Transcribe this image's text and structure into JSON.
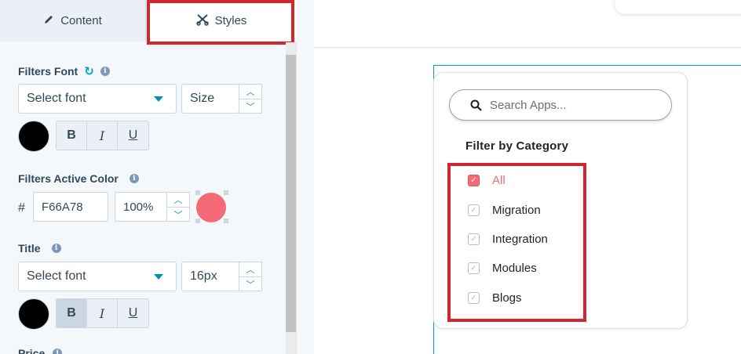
{
  "tabs": {
    "content_label": "Content",
    "styles_label": "Styles"
  },
  "filters_font": {
    "label": "Filters Font",
    "font_value": "Select font",
    "size_value": "Size",
    "bold": "B",
    "italic": "I",
    "underline": "U",
    "color": "#000000"
  },
  "filters_active_color": {
    "label": "Filters Active Color",
    "hash": "#",
    "hex_value": "F66A78",
    "opacity_value": "100%",
    "color": "#F66A78"
  },
  "title_section": {
    "label": "Title",
    "font_value": "Select font",
    "size_value": "16px",
    "bold": "B",
    "italic": "I",
    "underline": "U",
    "color": "#000000"
  },
  "next_section": {
    "label": "Price"
  },
  "preview": {
    "search_placeholder": "Search Apps...",
    "filter_title": "Filter by Category",
    "categories": [
      {
        "label": "All",
        "checked": true
      },
      {
        "label": "Migration",
        "checked": false
      },
      {
        "label": "Integration",
        "checked": false
      },
      {
        "label": "Modules",
        "checked": false
      },
      {
        "label": "Blogs",
        "checked": false
      }
    ]
  },
  "colors": {
    "accent": "#F66A78",
    "highlight_red": "#d0262e",
    "teal": "#00a4bd"
  },
  "icons": {
    "content_tab": "pencil-icon",
    "styles_tab": "scissors-icon",
    "refresh": "refresh-icon",
    "info": "info-icon",
    "search": "search-icon"
  }
}
